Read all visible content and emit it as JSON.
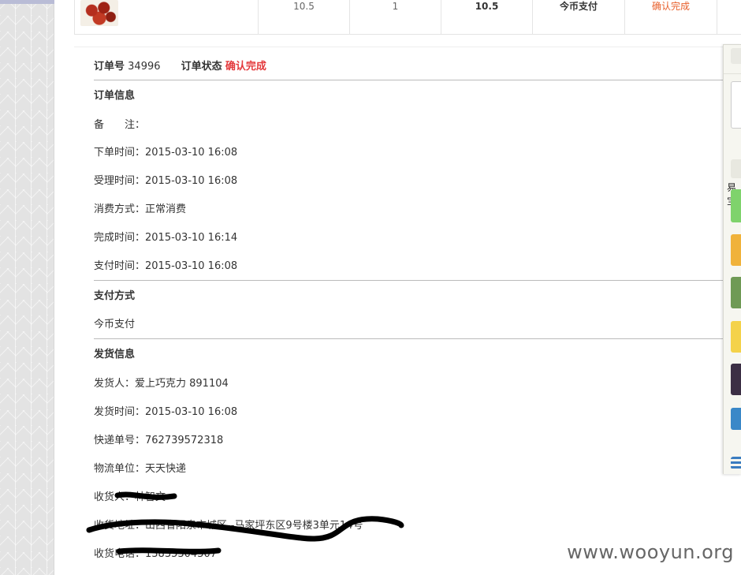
{
  "product_row": {
    "unit_price": "10.5",
    "quantity": "1",
    "subtotal": "10.5",
    "payment": "今币支付",
    "status_link": "确认完成"
  },
  "order": {
    "number_label": "订单号",
    "number": "34996",
    "status_label": "订单状态",
    "status": "确认完成"
  },
  "order_info": {
    "title": "订单信息",
    "remark": "备　　注：",
    "order_time": "下单时间：2015-03-10 16:08",
    "accept_time": "受理时间：2015-03-10 16:08",
    "consume_mode": "消费方式：正常消费",
    "complete_time": "完成时间：2015-03-10 16:14",
    "pay_time": "支付时间：2015-03-10 16:08"
  },
  "payment_section": {
    "title": "支付方式",
    "method": "今币支付"
  },
  "shipping": {
    "title": "发货信息",
    "sender": "发货人：爱上巧克力  891104",
    "ship_time": "发货时间：2015-03-10 16:08",
    "tracking_no": "快递单号：762739572318",
    "carrier": "物流单位：天天快递",
    "receiver": "收货人：林智文",
    "address": "收货地址：山西省阳泉市城区--马家坪东区9号楼3单元14号",
    "phone": "收货电话：13835304307"
  },
  "sidebar": {
    "label": "易宝"
  },
  "watermark": "www.wooyun.org"
}
